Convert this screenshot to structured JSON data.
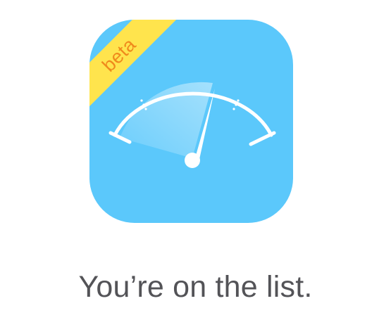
{
  "app_icon": {
    "icon_name": "speedometer-gauge-icon",
    "background_color": "#5bc8fb",
    "badge": {
      "label": "beta",
      "background_color": "#ffe44d",
      "text_color": "#f08a1c"
    }
  },
  "message": {
    "text": "You’re on the list.",
    "color": "#535357"
  }
}
